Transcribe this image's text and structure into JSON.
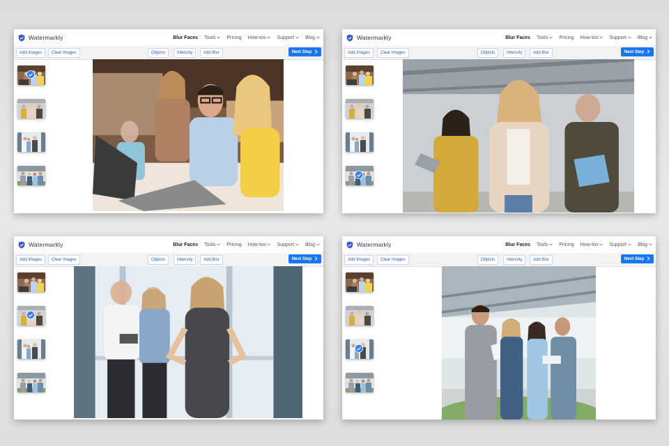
{
  "app": {
    "brand": "Watermarkly",
    "nav": [
      {
        "label": "Blur Faces",
        "active": true,
        "dropdown": false
      },
      {
        "label": "Tools",
        "active": false,
        "dropdown": true
      },
      {
        "label": "Pricing",
        "active": false,
        "dropdown": false
      },
      {
        "label": "How-tos",
        "active": false,
        "dropdown": true
      },
      {
        "label": "Support",
        "active": false,
        "dropdown": true
      },
      {
        "label": "Blog",
        "active": false,
        "dropdown": true
      }
    ],
    "toolbar": {
      "add_images": "Add Images",
      "clear_images": "Clear Images",
      "objects": "Objects",
      "intensity": "Intensity",
      "add_blur": "Add Blur",
      "next_step": "Next Step",
      "next_icon": "chevron-right-icon"
    }
  },
  "colors": {
    "accent": "#1976f2",
    "button_text": "#2a5fb7",
    "shield": "#3b56c9",
    "check_badge": "#2f80ed"
  },
  "panels": [
    {
      "id": "top-left",
      "selected_thumbnail": 1,
      "main_image": "office team at laptop with blurred face"
    },
    {
      "id": "top-right",
      "selected_thumbnail": 4,
      "main_image": "woman in beige jacket with two blurred colleagues"
    },
    {
      "id": "bottom-left",
      "selected_thumbnail": 2,
      "main_image": "woman in grey dress with two colleagues"
    },
    {
      "id": "bottom-right",
      "selected_thumbnail": 3,
      "main_image": "group of four colleagues with papers"
    }
  ]
}
